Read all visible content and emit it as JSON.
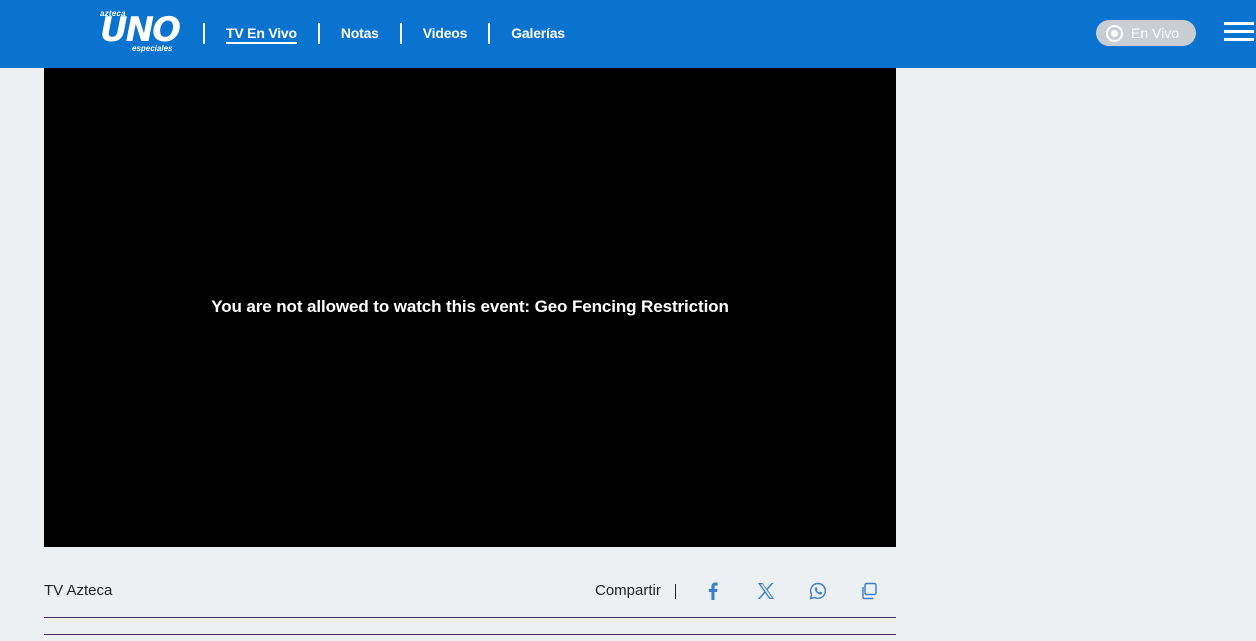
{
  "header": {
    "logo": {
      "top": "azteca",
      "main": "UNO",
      "sub": "especiales"
    },
    "nav": [
      {
        "label": "TV En Vivo",
        "active": true
      },
      {
        "label": "Notas",
        "active": false
      },
      {
        "label": "Videos",
        "active": false
      },
      {
        "label": "Galerías",
        "active": false
      }
    ],
    "live_label": "En Vivo",
    "brand_color": "#0a72cf"
  },
  "player": {
    "message": "You are not allowed to watch this event: Geo Fencing Restriction"
  },
  "meta": {
    "source": "TV Azteca",
    "share_label": "Compartir",
    "share_icons": [
      "facebook-icon",
      "x-icon",
      "whatsapp-icon",
      "copy-link-icon"
    ],
    "icon_color": "#3b7ecf"
  }
}
